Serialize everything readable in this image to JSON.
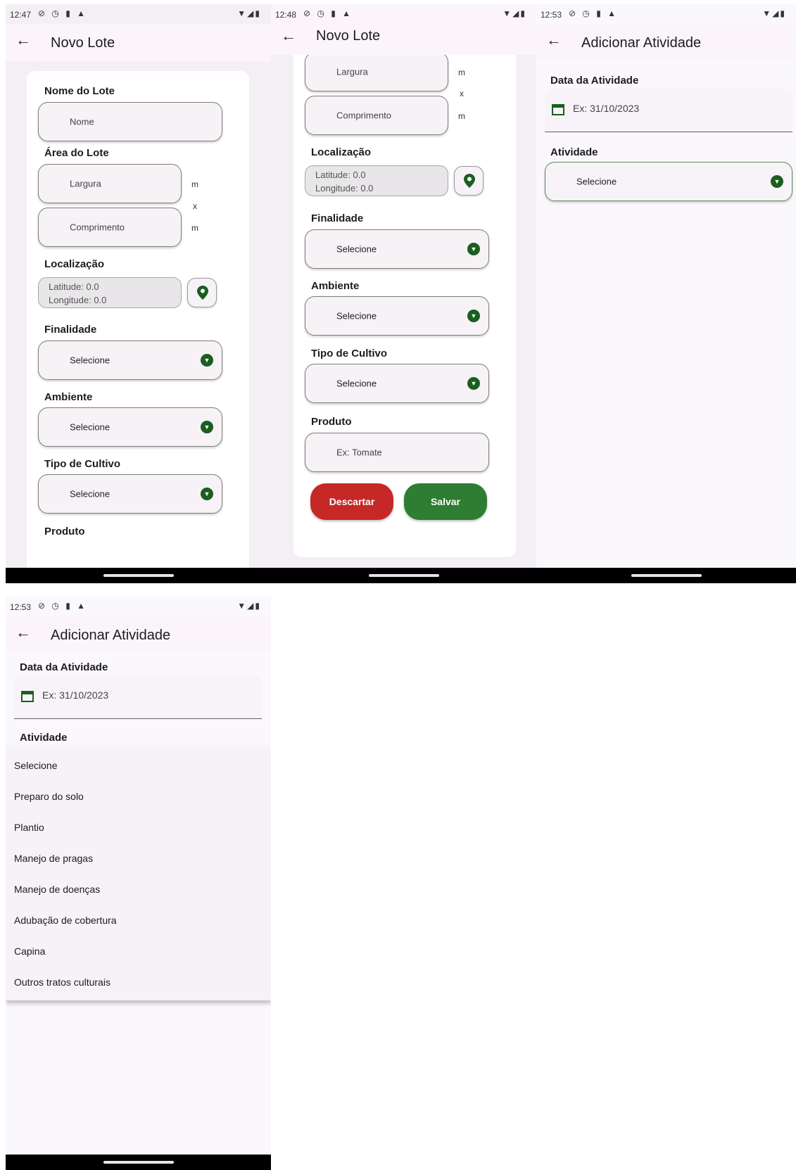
{
  "screens": [
    {
      "status": {
        "time": "12:47",
        "icons": "⊘ ◷ ▮ ▲",
        "right": "▼◢▮"
      },
      "appbar": {
        "back": "←",
        "title": "Novo Lote"
      },
      "form": {
        "nome_label": "Nome do Lote",
        "nome_placeholder": "Nome",
        "area_label": "Área do Lote",
        "largura_placeholder": "Largura",
        "comprimento_placeholder": "Comprimento",
        "unit_m": "m",
        "unit_x": "x",
        "loc_label": "Localização",
        "latitude": "Latitude: 0.0",
        "longitude": "Longitude: 0.0",
        "finalidade_label": "Finalidade",
        "finalidade_value": "Selecione",
        "ambiente_label": "Ambiente",
        "ambiente_value": "Selecione",
        "cultivo_label": "Tipo de Cultivo",
        "cultivo_value": "Selecione",
        "produto_label": "Produto"
      }
    },
    {
      "status": {
        "time": "12:48",
        "icons": "⊘ ◷ ▮ ▲",
        "right": "▼◢▮"
      },
      "appbar": {
        "back": "←",
        "title": "Novo Lote"
      },
      "form": {
        "largura_placeholder": "Largura",
        "comprimento_placeholder": "Comprimento",
        "unit_m": "m",
        "unit_x": "x",
        "loc_label": "Localização",
        "latitude": "Latitude: 0.0",
        "longitude": "Longitude: 0.0",
        "finalidade_label": "Finalidade",
        "finalidade_value": "Selecione",
        "ambiente_label": "Ambiente",
        "ambiente_value": "Selecione",
        "cultivo_label": "Tipo de Cultivo",
        "cultivo_value": "Selecione",
        "produto_label": "Produto",
        "produto_placeholder": "Ex: Tomate",
        "discard_label": "Descartar",
        "save_label": "Salvar"
      }
    },
    {
      "status": {
        "time": "12:53",
        "icons": "⊘ ◷ ▮ ▲",
        "right": "▼◢▮"
      },
      "appbar": {
        "back": "←",
        "title": "Adicionar Atividade"
      },
      "form": {
        "date_label": "Data da Atividade",
        "date_placeholder": "Ex: 31/10/2023",
        "atividade_label": "Atividade",
        "atividade_value": "Selecione"
      }
    },
    {
      "status": {
        "time": "12:53",
        "icons": "⊘ ◷ ▮ ▲",
        "right": "▼◢▮"
      },
      "appbar": {
        "back": "←",
        "title": "Adicionar Atividade"
      },
      "form": {
        "date_label": "Data da Atividade",
        "date_placeholder": "Ex: 31/10/2023",
        "atividade_label": "Atividade"
      },
      "menu_items": [
        "Selecione",
        "Preparo do solo",
        "Plantio",
        "Manejo de pragas",
        "Manejo de doenças",
        "Adubação de cobertura",
        "Capina",
        "Outros tratos culturais"
      ]
    }
  ],
  "colors": {
    "accent_green": "#1b5e20",
    "save_green": "#2e7d32",
    "discard_red": "#c62828"
  }
}
